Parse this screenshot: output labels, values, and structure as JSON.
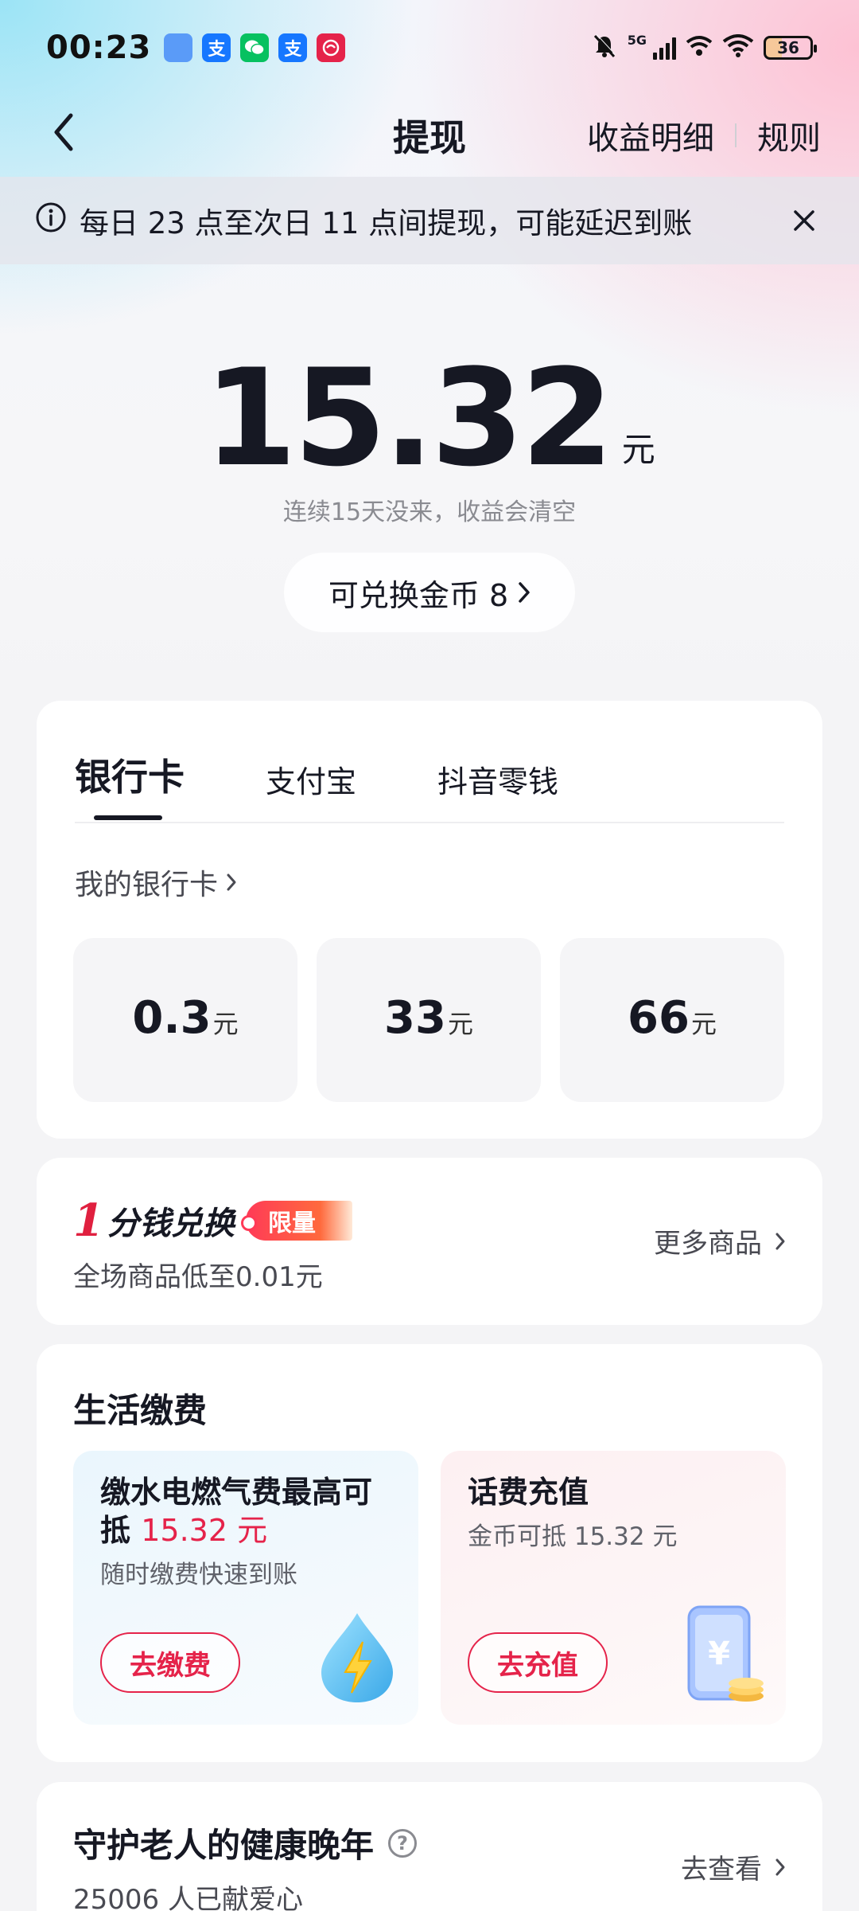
{
  "status_bar": {
    "time": "00:23",
    "network": "5G",
    "battery": "36",
    "app_icons": [
      {
        "name": "app-icon-1",
        "glyph": "",
        "color": "#4a8cf7"
      },
      {
        "name": "alipay-icon",
        "glyph": "支",
        "color": "#1677ff"
      },
      {
        "name": "wechat-icon",
        "glyph": "",
        "color": "#07c160"
      },
      {
        "name": "alipay-icon-2",
        "glyph": "支",
        "color": "#1677ff"
      },
      {
        "name": "app-icon-5",
        "glyph": "",
        "color": "#e5234a"
      }
    ]
  },
  "nav": {
    "title": "提现",
    "details_link": "收益明细",
    "rules_link": "规则"
  },
  "notice": {
    "text": "每日 23 点至次日 11 点间提现，可能延迟到账"
  },
  "balance": {
    "amount": "15.32",
    "unit": "元",
    "hint": "连续15天没来，收益会清空",
    "coins_label": "可兑换金币 8"
  },
  "withdraw": {
    "tabs": [
      "银行卡",
      "支付宝",
      "抖音零钱"
    ],
    "active_tab": 0,
    "my_card": "我的银行卡",
    "options": [
      {
        "value": "0.3",
        "unit": "元"
      },
      {
        "value": "33",
        "unit": "元"
      },
      {
        "value": "66",
        "unit": "元"
      }
    ]
  },
  "promo": {
    "one": "1",
    "title": "分钱兑换",
    "tag": "限量",
    "subtitle": "全场商品低至0.01元",
    "more": "更多商品"
  },
  "bills": {
    "title": "生活缴费",
    "utility": {
      "title": "缴水电燃气费最高可抵",
      "amount": "15.32 元",
      "subtitle": "随时缴费快速到账",
      "button": "去缴费"
    },
    "phone": {
      "title": "话费充值",
      "subtitle": "金币可抵 15.32 元",
      "button": "去充值"
    }
  },
  "charity": {
    "title": "守护老人的健康晚年",
    "help": "?",
    "subtitle": "25006 人已献爱心",
    "link": "去查看"
  },
  "colors": {
    "accent_red": "#e5234a",
    "text_primary": "#161823",
    "text_secondary": "#494a52"
  }
}
